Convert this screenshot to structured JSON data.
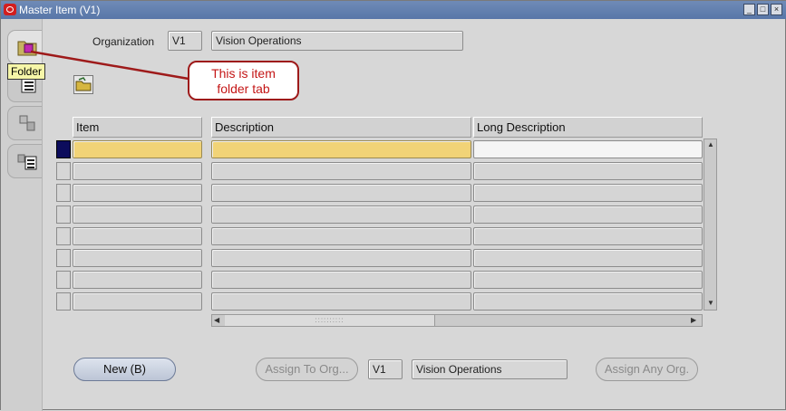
{
  "window": {
    "title": "Master Item (V1)"
  },
  "organization": {
    "label": "Organization",
    "code": "V1",
    "name": "Vision Operations"
  },
  "tabs": [
    {
      "name": "folder",
      "tooltip": "Folder"
    },
    {
      "name": "list"
    },
    {
      "name": "items"
    },
    {
      "name": "items-list"
    }
  ],
  "callout": {
    "line1": "This is item",
    "line2": "folder tab"
  },
  "grid": {
    "columns": [
      "Item",
      "Description",
      "Long Description"
    ],
    "row_count": 8
  },
  "buttons": {
    "new": "New (B)",
    "assign_to_org": "Assign To Org...",
    "assign_any_org": "Assign Any Org."
  },
  "assign_org": {
    "code": "V1",
    "name": "Vision Operations"
  },
  "colors": {
    "titlebar": "#5876a8",
    "current_row": "#f1d377",
    "callout_border": "#9e1a1a"
  }
}
